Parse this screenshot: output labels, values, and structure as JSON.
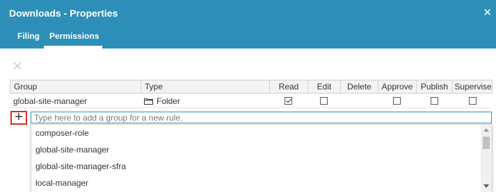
{
  "dialog": {
    "title": "Downloads - Properties",
    "close_icon": "close-icon",
    "tabs": [
      {
        "label": "Filing",
        "active": false
      },
      {
        "label": "Permissions",
        "active": true
      }
    ]
  },
  "toolbar": {
    "delete_icon": "close-icon"
  },
  "grid": {
    "columns": [
      "Group",
      "Type",
      "Read",
      "Edit",
      "Delete",
      "Approve",
      "Publish",
      "Supervise"
    ],
    "rows": [
      {
        "group": "global-site-manager",
        "type": "Folder",
        "type_icon": "folder-icon",
        "read": true,
        "edit": false,
        "delete": null,
        "approve": false,
        "publish": false,
        "supervise": false
      }
    ]
  },
  "new_rule": {
    "add_icon": "plus-icon",
    "placeholder": "Type here to add a group for a new rule.",
    "value": ""
  },
  "suggestions": [
    "composer-role",
    "global-site-manager",
    "global-site-manager-sfra",
    "local-manager"
  ],
  "colors": {
    "header_bg": "#2d8fb8",
    "highlight_border": "#e0281e"
  }
}
